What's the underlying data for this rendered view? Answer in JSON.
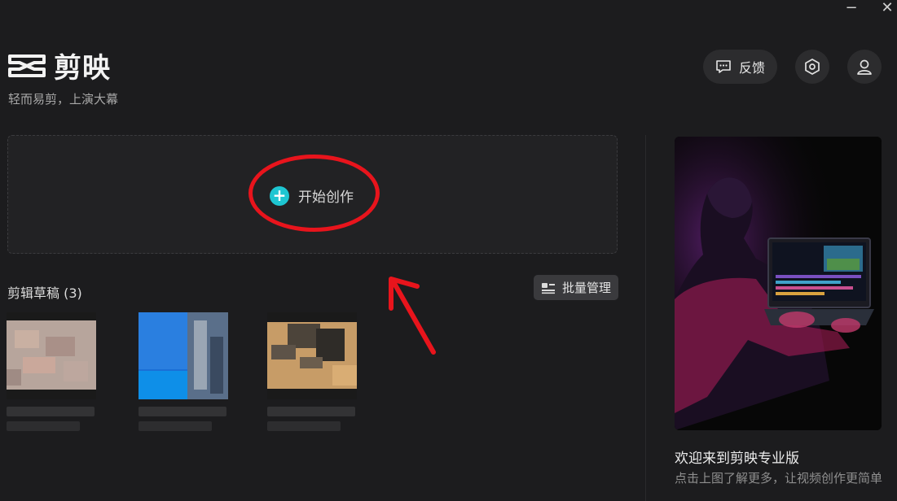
{
  "window": {
    "minimize_glyph": "−",
    "close_glyph": "✕"
  },
  "app": {
    "name": "剪映",
    "tagline": "轻而易剪，上演大幕"
  },
  "header": {
    "feedback_label": "反馈",
    "settings_icon": "hexagon-settings-icon",
    "account_icon": "user-icon"
  },
  "create": {
    "label": "开始创作",
    "icon": "plus-circle-icon",
    "accent": "#1ec6d2"
  },
  "drafts": {
    "title": "剪辑草稿 (3)",
    "batch_label": "批量管理"
  },
  "promo": {
    "title": "欢迎来到剪映专业版",
    "description": "点击上图了解更多，让视频创作更简单"
  },
  "annotation": {
    "color": "#e8141c"
  }
}
